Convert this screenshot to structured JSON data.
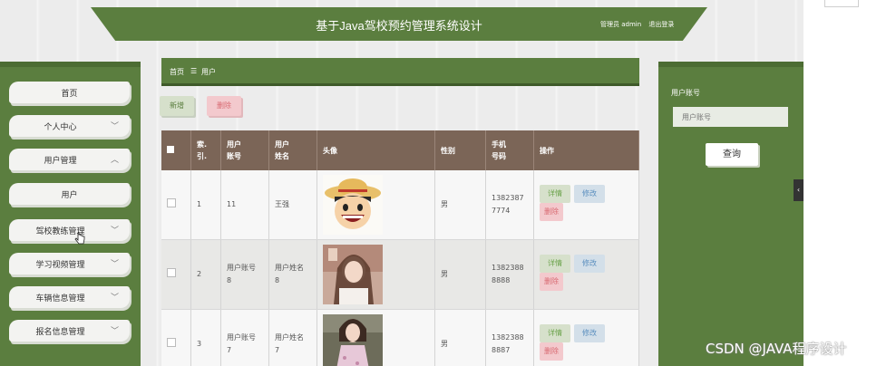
{
  "header": {
    "title": "基于Java驾校预约管理系统设计",
    "admin_label": "管理员 admin",
    "logout_label": "退出登录"
  },
  "sidebar": {
    "items": [
      {
        "label": "首页",
        "has_chevron": false
      },
      {
        "label": "个人中心",
        "chevron": "﹀"
      },
      {
        "label": "用户管理",
        "chevron": "︿"
      },
      {
        "label": "用户",
        "has_chevron": false
      },
      {
        "label": "驾校教练管理",
        "chevron": "﹀"
      },
      {
        "label": "学习视频管理",
        "chevron": "﹀"
      },
      {
        "label": "车辆信息管理",
        "chevron": "﹀"
      },
      {
        "label": "报名信息管理",
        "chevron": "﹀"
      }
    ]
  },
  "breadcrumb": {
    "home": "首页",
    "separator": "☰",
    "current": "用户"
  },
  "toolbar": {
    "add_label": "新增",
    "delete_label": "删除"
  },
  "table": {
    "headers": {
      "index": "索.\n引.",
      "account": "用户\n账号",
      "name": "用户\n姓名",
      "avatar": "头像",
      "gender": "性别",
      "phone": "手机\n号码",
      "actions": "操作"
    },
    "rows": [
      {
        "index": "1",
        "account": "11",
        "name": "王强",
        "avatar": "cartoon-avatar",
        "gender": "男",
        "phone": "1382387\n7774"
      },
      {
        "index": "2",
        "account": "用户账号\n8",
        "name": "用户姓名\n8",
        "avatar": "photo-avatar-1",
        "gender": "男",
        "phone": "1382388\n8888"
      },
      {
        "index": "3",
        "account": "用户账号\n7",
        "name": "用户姓名\n7",
        "avatar": "photo-avatar-2",
        "gender": "男",
        "phone": "1382388\n8887"
      }
    ],
    "action_labels": {
      "detail": "详情",
      "edit": "修改",
      "delete": "删除"
    }
  },
  "search": {
    "label": "用户账号",
    "placeholder": "用户账号",
    "button_label": "查询"
  },
  "side_tab_glyph": "‹",
  "watermark": "CSDN @JAVA程序设计",
  "colors": {
    "primary": "#5b7e3f",
    "table_header": "#7b6557",
    "danger": "#d86a72",
    "info": "#5b8fbf",
    "success": "#6aa24a"
  }
}
